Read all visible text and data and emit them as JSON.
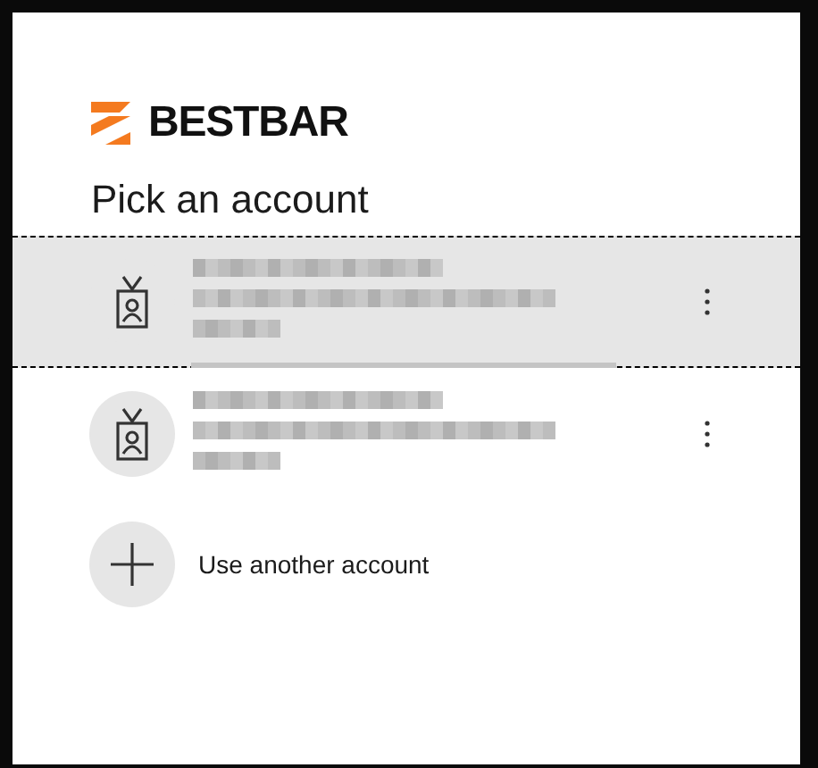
{
  "brand": {
    "name": "BESTBAR"
  },
  "title": "Pick an account",
  "accounts": [
    {
      "selected": true
    },
    {
      "selected": false
    }
  ],
  "add_account": {
    "label": "Use another account"
  }
}
